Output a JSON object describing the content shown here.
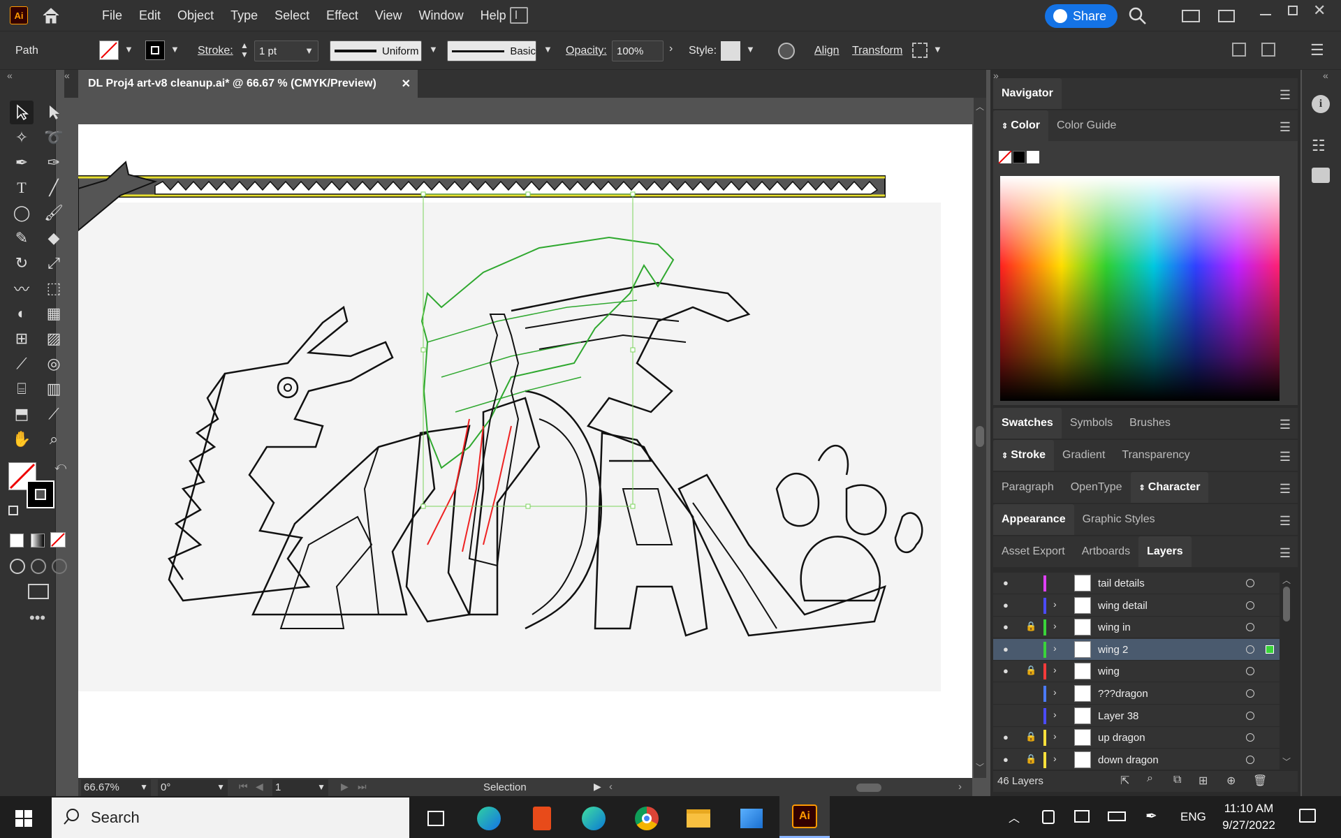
{
  "app": {
    "badge": "Ai"
  },
  "menu": [
    "File",
    "Edit",
    "Object",
    "Type",
    "Select",
    "Effect",
    "View",
    "Window",
    "Help"
  ],
  "share": {
    "label": "Share"
  },
  "control": {
    "selection_type": "Path",
    "stroke_label": "Stroke:",
    "stroke_weight": "1 pt",
    "profile": "Uniform",
    "brush": "Basic",
    "opacity_label": "Opacity:",
    "opacity_value": "100%",
    "style_label": "Style:",
    "align": "Align",
    "transform": "Transform"
  },
  "document": {
    "tab_title": "DL Proj4 art-v8 cleanup.ai* @ 66.67 % (CMYK/Preview)"
  },
  "status": {
    "zoom": "66.67%",
    "rotation": "0°",
    "artboard": "1",
    "tool": "Selection"
  },
  "panels": {
    "navigator": "Navigator",
    "color_tabs": [
      "Color",
      "Color Guide"
    ],
    "swatch_tabs": [
      "Swatches",
      "Symbols",
      "Brushes"
    ],
    "stroke_tabs": [
      "Stroke",
      "Gradient",
      "Transparency"
    ],
    "char_tabs": [
      "Paragraph",
      "OpenType",
      "Character"
    ],
    "appearance_tabs": [
      "Appearance",
      "Graphic Styles"
    ],
    "layer_tabs": [
      "Asset Export",
      "Artboards",
      "Layers"
    ],
    "layers_count": "46 Layers"
  },
  "layers": [
    {
      "name": "tail details",
      "color": "#e040fb",
      "visible": true,
      "locked": false,
      "expand": false
    },
    {
      "name": "wing detail",
      "color": "#4b4bff",
      "visible": true,
      "locked": false,
      "expand": true
    },
    {
      "name": "wing in",
      "color": "#3ad43a",
      "visible": true,
      "locked": true,
      "expand": true
    },
    {
      "name": "wing 2",
      "color": "#3ad43a",
      "visible": true,
      "locked": false,
      "expand": true
    },
    {
      "name": "wing",
      "color": "#ff3b3b",
      "visible": true,
      "locked": true,
      "expand": true
    },
    {
      "name": "???dragon",
      "color": "#4b7bff",
      "visible": false,
      "locked": false,
      "expand": true
    },
    {
      "name": "Layer 38",
      "color": "#4b4bff",
      "visible": false,
      "locked": false,
      "expand": true
    },
    {
      "name": "up dragon",
      "color": "#ffe03b",
      "visible": true,
      "locked": true,
      "expand": true
    },
    {
      "name": "down dragon",
      "color": "#ffe03b",
      "visible": true,
      "locked": true,
      "expand": true
    }
  ],
  "taskbar": {
    "search": "Search",
    "lang": "ENG",
    "time": "11:10 AM",
    "date": "9/27/2022"
  },
  "colors": {
    "accent": "#1473e6",
    "selection": "#7ad35a",
    "ai_orange": "#ff9a00",
    "ai_bg": "#330000"
  }
}
